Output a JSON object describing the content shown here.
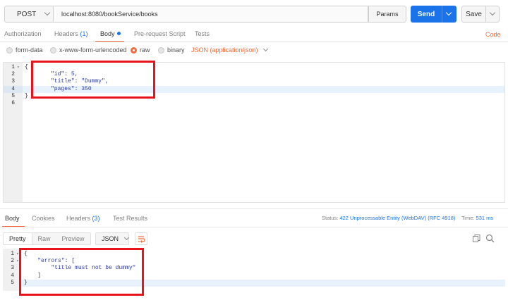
{
  "request": {
    "method": "POST",
    "url": "localhost:8080/bookService/books",
    "params_label": "Params",
    "send_label": "Send",
    "save_label": "Save"
  },
  "request_tabs": {
    "authorization": "Authorization",
    "headers": "Headers",
    "headers_count": "(1)",
    "body": "Body",
    "pre_request": "Pre-request Script",
    "tests": "Tests",
    "code": "Code"
  },
  "body_types": {
    "form_data": "form-data",
    "urlencoded": "x-www-form-urlencoded",
    "raw": "raw",
    "binary": "binary",
    "content_type": "JSON (application/json)",
    "selected": "raw"
  },
  "request_body": {
    "lines": [
      {
        "n": "1",
        "text": "{"
      },
      {
        "n": "2",
        "key": "\"id\"",
        "value": " 5,"
      },
      {
        "n": "3",
        "key": "\"title\"",
        "value": " \"Dummy\","
      },
      {
        "n": "4",
        "key": "\"pages\"",
        "value": " 350"
      },
      {
        "n": "5",
        "text": "}"
      },
      {
        "n": "6",
        "text": ""
      }
    ]
  },
  "response_tabs": {
    "body": "Body",
    "cookies": "Cookies",
    "headers": "Headers",
    "headers_count": "(3)",
    "test_results": "Test Results"
  },
  "response_status": {
    "status_label": "Status:",
    "status_value": "422 Unprocessable Entity (WebDAV) (RFC 4918)",
    "time_label": "Time:",
    "time_value": "531 ms"
  },
  "response_view": {
    "pretty": "Pretty",
    "raw": "Raw",
    "preview": "Preview",
    "format": "JSON"
  },
  "response_body": {
    "lines": [
      {
        "n": "1",
        "text": "{"
      },
      {
        "n": "2",
        "text": "    \"errors\": ["
      },
      {
        "n": "3",
        "text": "        \"title must not be dummy\""
      },
      {
        "n": "4",
        "text": "    ]"
      },
      {
        "n": "5",
        "text": "}"
      }
    ]
  },
  "colors": {
    "accent": "#f26b3a",
    "send": "#1a73e8",
    "highlight_box": "#e8141b"
  }
}
